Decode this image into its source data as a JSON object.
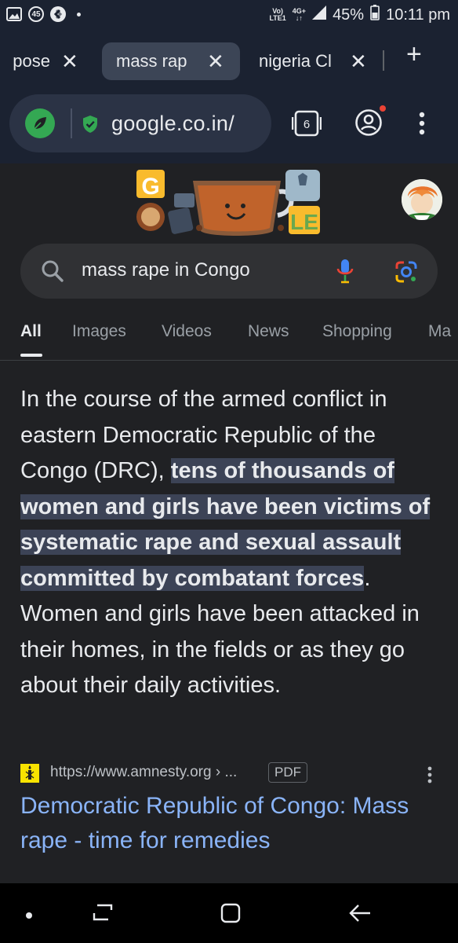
{
  "status_bar": {
    "notification_badge": "45",
    "network_top": "Vo)",
    "network_bottom": "LTE1",
    "data_top": "4G+",
    "data_bottom": "↓↑",
    "battery": "45%",
    "time": "10:11 pm"
  },
  "tabs": [
    {
      "label": "pose",
      "close": "✕"
    },
    {
      "label": "mass rap",
      "close": "✕"
    },
    {
      "label": "nigeria Cl",
      "close": "✕"
    }
  ],
  "new_tab": "+",
  "omnibox": {
    "url": "google.co.in/"
  },
  "tab_count": "6",
  "search": {
    "query": "mass rape in Congo"
  },
  "nav_tabs": [
    "All",
    "Images",
    "Videos",
    "News",
    "Shopping",
    "Ma"
  ],
  "snippet": {
    "before": "In the course of the armed conflict in eastern Democratic Republic of the Congo (DRC), ",
    "highlight": "tens of thousands of women and girls have been victims of systematic rape and sexual assault committed by combatant forces",
    "after": ". Women and girls have been attacked in their homes, in the fields or as they go about their daily activities."
  },
  "result": {
    "source_url": "https://www.amnesty.org › ...",
    "badge": "PDF",
    "title": "Democratic Republic of Congo: Mass rape - time for remedies"
  },
  "colors": {
    "browser_chrome": "#1b2231",
    "page_background": "#202124",
    "link": "#8ab4f8",
    "highlight": "#3c4356"
  }
}
